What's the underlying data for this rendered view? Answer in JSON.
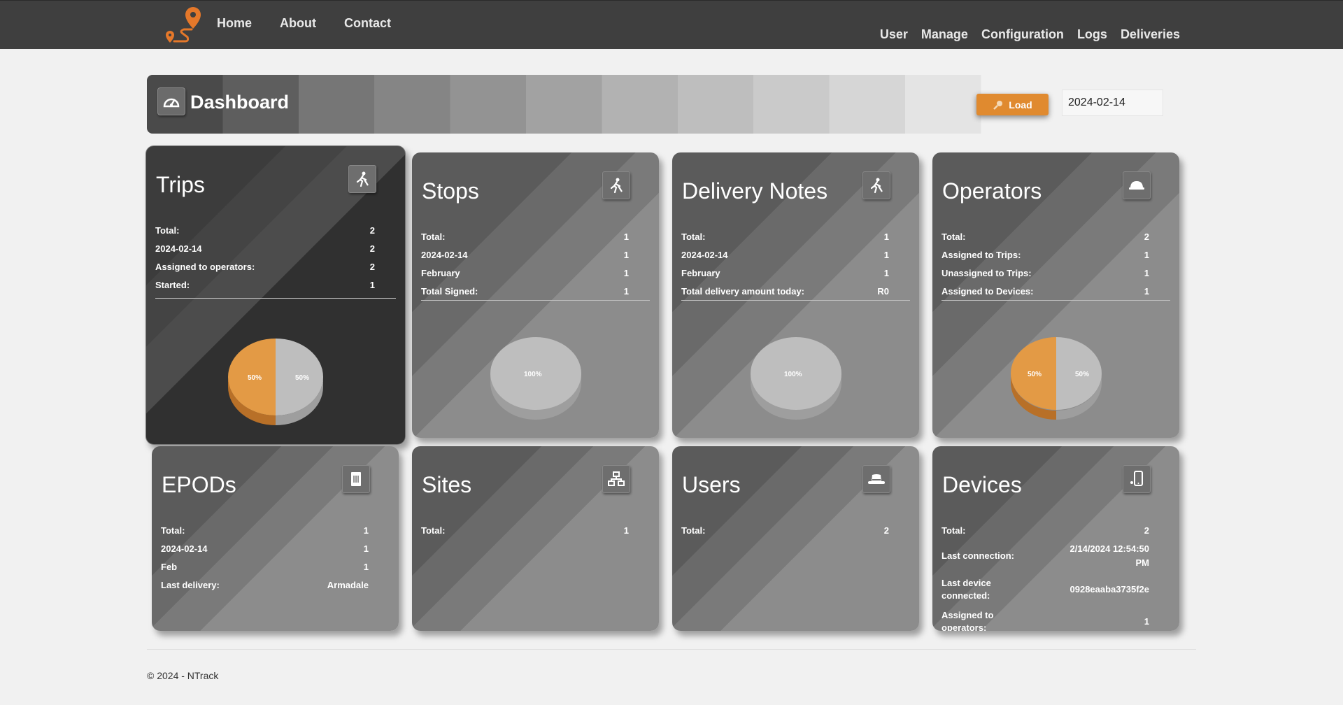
{
  "nav": {
    "left": [
      "Home",
      "About",
      "Contact"
    ],
    "right": [
      "User",
      "Manage",
      "Configuration",
      "Logs",
      "Deliveries"
    ],
    "accent": "#e08a2f",
    "bar_color": "#3f3f3f"
  },
  "dashboard": {
    "title": "Dashboard",
    "load_label": "Load",
    "date": "2024-02-14"
  },
  "cards": {
    "trips": {
      "title": "Trips",
      "icon": "walking-person-icon",
      "rows": [
        [
          "Total:",
          "2"
        ],
        [
          "2024-02-14",
          "2"
        ],
        [
          "Assigned to operators:",
          "2"
        ],
        [
          "Started:",
          "1"
        ]
      ],
      "pie_labels": [
        "50%",
        "50%"
      ]
    },
    "stops": {
      "title": "Stops",
      "icon": "walking-person-icon",
      "rows": [
        [
          "Total:",
          "1"
        ],
        [
          "2024-02-14",
          "1"
        ],
        [
          "February",
          "1"
        ],
        [
          "Total Signed:",
          "1"
        ]
      ],
      "pie_labels": [
        "100%"
      ]
    },
    "delivery_notes": {
      "title": "Delivery Notes",
      "icon": "walking-person-icon",
      "rows": [
        [
          "Total:",
          "1"
        ],
        [
          "2024-02-14",
          "1"
        ],
        [
          "February",
          "1"
        ],
        [
          "Total delivery amount today:",
          "R0"
        ]
      ],
      "pie_labels": [
        "100%"
      ]
    },
    "operators": {
      "title": "Operators",
      "icon": "hard-hat-icon",
      "rows": [
        [
          "Total:",
          "2"
        ],
        [
          "Assigned to Trips:",
          "1"
        ],
        [
          "Unassigned to Trips:",
          "1"
        ],
        [
          "Assigned to Devices:",
          "1"
        ]
      ],
      "pie_labels": [
        "50%",
        "50%"
      ]
    },
    "epods": {
      "title": "EPODs",
      "icon": "document-icon",
      "rows": [
        [
          "Total:",
          "1"
        ],
        [
          "2024-02-14",
          "1"
        ],
        [
          "Feb",
          "1"
        ],
        [
          "Last delivery:",
          "Armadale"
        ]
      ]
    },
    "sites": {
      "title": "Sites",
      "icon": "sitemap-icon",
      "rows": [
        [
          "Total:",
          "1"
        ]
      ]
    },
    "users": {
      "title": "Users",
      "icon": "hat-icon",
      "rows": [
        [
          "Total:",
          "2"
        ]
      ]
    },
    "devices": {
      "title": "Devices",
      "icon": "mobile-device-icon",
      "rows": [
        [
          "Total:",
          "2"
        ],
        [
          "Last connection:",
          "2/14/2024 12:54:50 PM"
        ],
        [
          "Last device connected:",
          "0928eaaba3735f2e"
        ],
        [
          "Assigned to operators:",
          "1"
        ]
      ]
    }
  },
  "footer": "© 2024 - NTrack"
}
